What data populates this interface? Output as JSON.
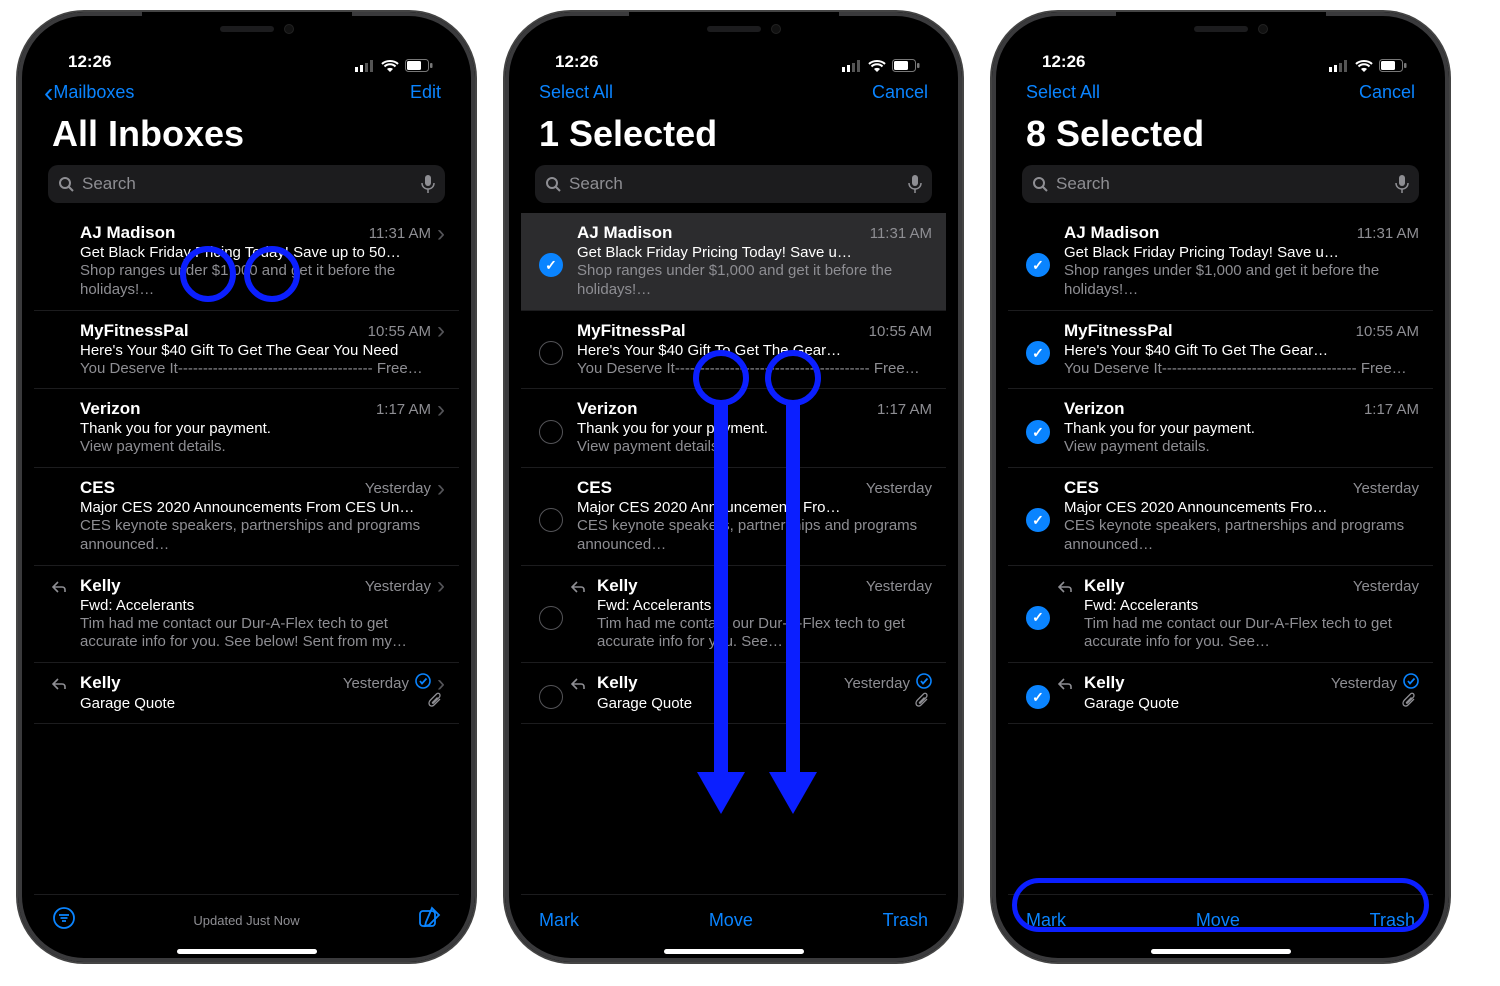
{
  "statusbar": {
    "time": "12:26"
  },
  "search": {
    "placeholder": "Search"
  },
  "screens": [
    {
      "nav_left_back": "Mailboxes",
      "nav_right": "Edit",
      "title": "All Inboxes",
      "footer_status": "Updated Just Now",
      "mode": "view"
    },
    {
      "nav_left": "Select All",
      "nav_right": "Cancel",
      "title": "1 Selected",
      "footer_mark": "Mark",
      "footer_move": "Move",
      "footer_trash": "Trash",
      "mode": "select",
      "selected": [
        true,
        false,
        false,
        false,
        false,
        false
      ]
    },
    {
      "nav_left": "Select All",
      "nav_right": "Cancel",
      "title": "8 Selected",
      "footer_mark": "Mark",
      "footer_move": "Move",
      "footer_trash": "Trash",
      "mode": "select",
      "selected": [
        true,
        true,
        true,
        true,
        true,
        true
      ]
    }
  ],
  "emails": [
    {
      "sender": "AJ Madison",
      "time": "11:31 AM",
      "subject_full": "Get Black Friday Pricing Today! Save up to 50…",
      "subject_trunc": "Get Black Friday Pricing Today! Save u…",
      "preview": "Shop ranges under $1,000 and get it before the holidays!…",
      "flag": false,
      "reply": false,
      "attach": false
    },
    {
      "sender": "MyFitnessPal",
      "time": "10:55 AM",
      "subject_full": "Here's Your $40 Gift To Get The Gear You Need",
      "subject_trunc": "Here's Your $40 Gift To Get The Gear…",
      "preview": "You Deserve It--------------------------------------- Free…",
      "flag": false,
      "reply": false,
      "attach": false
    },
    {
      "sender": "Verizon",
      "time": "1:17 AM",
      "subject_full": "Thank you for your payment.",
      "subject_trunc": "Thank you for your payment.",
      "preview": "View payment details.",
      "flag": false,
      "reply": false,
      "attach": false
    },
    {
      "sender": "CES",
      "time": "Yesterday",
      "subject_full": "Major CES 2020 Announcements From CES Un…",
      "subject_trunc": "Major CES 2020 Announcements Fro…",
      "preview": "CES keynote speakers, partnerships and programs announced…",
      "flag": false,
      "reply": false,
      "attach": false
    },
    {
      "sender": "Kelly",
      "time": "Yesterday",
      "subject_full": "Fwd: Accelerants",
      "subject_trunc": "Fwd: Accelerants",
      "preview_full": "Tim had me contact our Dur-A-Flex tech to get accurate info for you. See below! Sent from my…",
      "preview_trunc": "Tim had me contact our Dur-A-Flex tech to get accurate info for you. See…",
      "flag": false,
      "reply": true,
      "attach": false
    },
    {
      "sender": "Kelly",
      "time": "Yesterday",
      "subject_full": "Garage Quote",
      "subject_trunc": "Garage Quote",
      "preview": "",
      "flag": true,
      "reply": true,
      "attach": true
    }
  ]
}
